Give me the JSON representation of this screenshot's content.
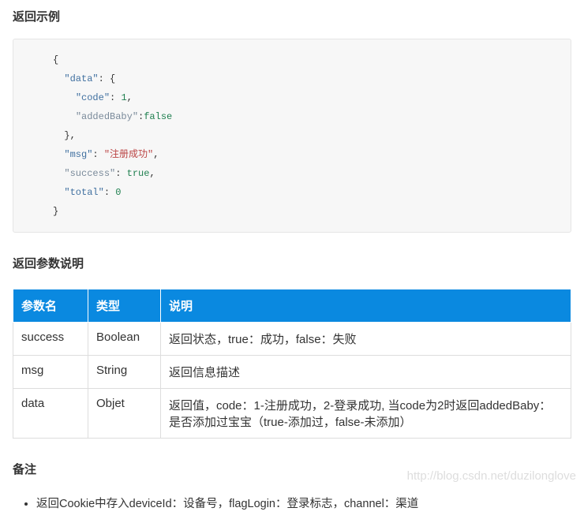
{
  "section_return_example": "返回示例",
  "code": {
    "l1": "{",
    "l2_key": "\"data\"",
    "l2_rest": ": {",
    "l3_key": "\"code\"",
    "l3_rest": ": ",
    "l3_val": "1",
    "l3_end": ",",
    "l4_key": "\"addedBaby\"",
    "l4_rest": ":",
    "l4_val": "false",
    "l5": "},",
    "l6_key": "\"msg\"",
    "l6_rest": ": ",
    "l6_val": "\"注册成功\"",
    "l6_end": ",",
    "l7_key": "\"success\"",
    "l7_rest": ": ",
    "l7_val": "true",
    "l7_end": ",",
    "l8_key": "\"total\"",
    "l8_rest": ": ",
    "l8_val": "0",
    "l9": "}"
  },
  "section_return_params": "返回参数说明",
  "table": {
    "headers": {
      "name": "参数名",
      "type": "类型",
      "desc": "说明"
    },
    "rows": [
      {
        "name": "success",
        "type": "Boolean",
        "desc": "返回状态，true：成功，false：失败"
      },
      {
        "name": "msg",
        "type": "String",
        "desc": "返回信息描述"
      },
      {
        "name": "data",
        "type": "Objet",
        "desc": "返回值，code：1-注册成功，2-登录成功, 当code为2时返回addedBaby：是否添加过宝宝（true-添加过，false-未添加）"
      }
    ]
  },
  "section_remark": "备注",
  "remark_item": "返回Cookie中存入deviceId：设备号，flagLogin：登录标志，channel：渠道",
  "watermark": "http://blog.csdn.net/duzilonglove"
}
